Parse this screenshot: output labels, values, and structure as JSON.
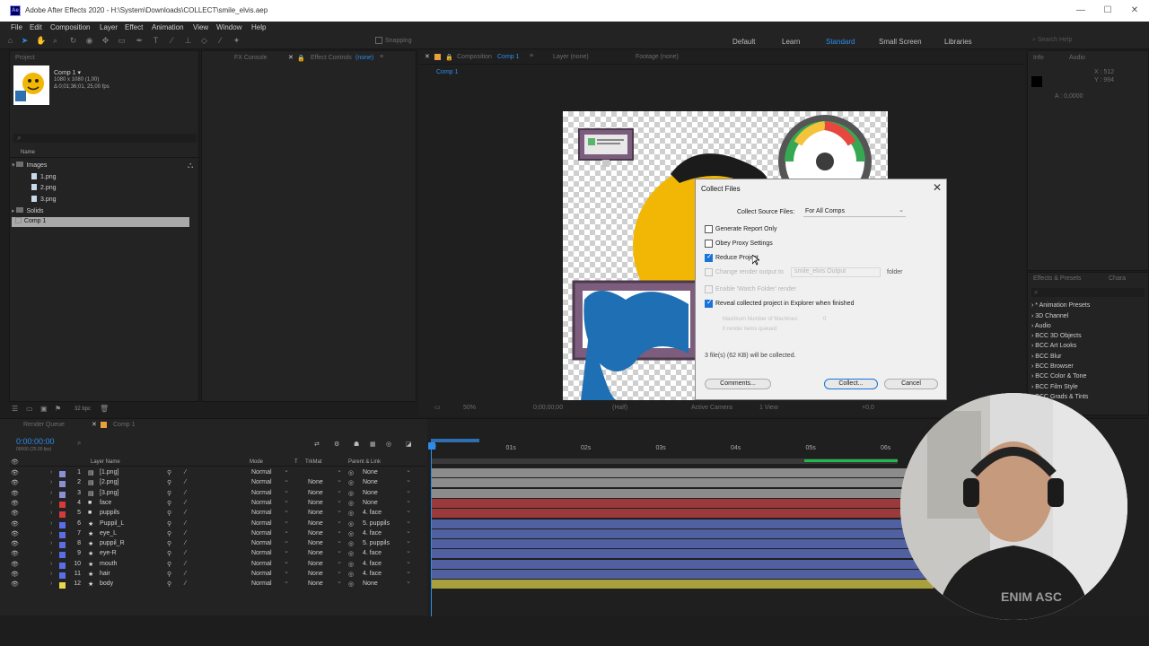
{
  "window": {
    "title": "Adobe After Effects 2020 - H:\\System\\Downloads\\COLLECT\\smile_elvis.aep",
    "logo_text": "Ae",
    "minimize": "—",
    "maximize": "☐",
    "close": "✕"
  },
  "menu": [
    "File",
    "Edit",
    "Composition",
    "Layer",
    "Effect",
    "Animation",
    "View",
    "Window",
    "Help"
  ],
  "toolbar": {
    "snapping": "Snapping",
    "workspaces": [
      "Default",
      "Learn",
      "Standard",
      "Small Screen",
      "Libraries"
    ],
    "active_workspace": "Standard",
    "search_placeholder": "Search Help"
  },
  "project": {
    "tab": "Project",
    "comp_name": "Comp 1 ▾",
    "comp_info1": "1080 x 1080 (1,00)",
    "comp_info2": "Δ 0;01;36;01, 25,00 fps",
    "name_header": "Name",
    "items": [
      {
        "label": "Images",
        "type": "folder"
      },
      {
        "label": "1.png",
        "type": "file"
      },
      {
        "label": "2.png",
        "type": "file"
      },
      {
        "label": "3.png",
        "type": "file"
      },
      {
        "label": "Solids",
        "type": "folder"
      },
      {
        "label": "Comp 1",
        "type": "comp"
      }
    ],
    "bpc": "32 bpc"
  },
  "effect_controls": {
    "fx_console": "FX Console",
    "tab": "Effect Controls",
    "none": "(none)"
  },
  "composition": {
    "tab": "Composition",
    "comp": "Comp 1",
    "layer_tab": "Layer (none)",
    "footage_tab": "Footage (none)",
    "sub_tab": "Comp 1",
    "zoom": "50%",
    "timecode": "0;00;00;00",
    "resolution": "(Half)",
    "camera": "Active Camera",
    "views": "1 View",
    "exposure": "+0,0"
  },
  "dialog": {
    "title": "Collect Files",
    "close": "✕",
    "source_label": "Collect Source Files:",
    "source_value": "For All Comps",
    "options": [
      {
        "label": "Generate Report Only",
        "checked": false,
        "disabled": false
      },
      {
        "label": "Obey Proxy Settings",
        "checked": false,
        "disabled": false
      },
      {
        "label": "Reduce Project",
        "checked": true,
        "disabled": false
      },
      {
        "label": "Change render output to",
        "checked": false,
        "disabled": true
      },
      {
        "label": "Enable 'Watch Folder' render",
        "checked": false,
        "disabled": true
      },
      {
        "label": "Reveal collected project in Explorer when finished",
        "checked": true,
        "disabled": false
      }
    ],
    "output_folder": "smile_elvis Output",
    "folder_label": "folder",
    "max_machines": "Maximum Number of Machines:",
    "max_machines_value": "0",
    "render_items": "0 render items queued",
    "summary": "3 file(s) (62 KB) will be collected.",
    "comments_btn": "Comments...",
    "collect_btn": "Collect...",
    "cancel_btn": "Cancel"
  },
  "info": {
    "tab": "Info",
    "audio_tab": "Audio",
    "x": "X : 512",
    "y": "Y : 994",
    "a": "A : 0,0000"
  },
  "effects": {
    "tab": "Effects & Presets",
    "char_tab": "Chara",
    "items": [
      "* Animation Presets",
      "3D Channel",
      "Audio",
      "BCC 3D Objects",
      "BCC Art Looks",
      "BCC Blur",
      "BCC Browser",
      "BCC Color & Tone",
      "BCC Film Style",
      "BCC Grads & Tints"
    ]
  },
  "timeline": {
    "render_queue": "Render Queue",
    "comp_tab": "Comp 1",
    "timecode": "0:00:00:00",
    "frame_info": "00000 (25.00 fps)",
    "columns": {
      "layer_name": "Layer Name",
      "mode": "Mode",
      "t": "T",
      "trkmat": "TrkMat",
      "parent": "Parent & Link"
    },
    "ruler": [
      "0f",
      "01s",
      "02s",
      "03s",
      "04s",
      "05s",
      "06s"
    ],
    "layers": [
      {
        "num": "1",
        "name": "[1.png]",
        "type": "file",
        "color": "#8b8fd6",
        "mode": "Normal",
        "trkmat": "",
        "parent": "None"
      },
      {
        "num": "2",
        "name": "[2.png]",
        "type": "file",
        "color": "#8b8fd6",
        "mode": "Normal",
        "trkmat": "None",
        "parent": "None"
      },
      {
        "num": "3",
        "name": "[3.png]",
        "type": "file",
        "color": "#8b8fd6",
        "mode": "Normal",
        "trkmat": "None",
        "parent": "None"
      },
      {
        "num": "4",
        "name": "face",
        "type": "solid",
        "color": "#d73a3a",
        "mode": "Normal",
        "trkmat": "None",
        "parent": "None"
      },
      {
        "num": "5",
        "name": "puppils",
        "type": "solid",
        "color": "#d73a3a",
        "mode": "Normal",
        "trkmat": "None",
        "parent": "4. face"
      },
      {
        "num": "6",
        "name": "Puppil_L",
        "type": "shape",
        "color": "#5b6ee6",
        "mode": "Normal",
        "trkmat": "None",
        "parent": "5. puppils"
      },
      {
        "num": "7",
        "name": "eye_L",
        "type": "shape",
        "color": "#5b6ee6",
        "mode": "Normal",
        "trkmat": "None",
        "parent": "4. face"
      },
      {
        "num": "8",
        "name": "puppil_R",
        "type": "shape",
        "color": "#5b6ee6",
        "mode": "Normal",
        "trkmat": "None",
        "parent": "5. puppils"
      },
      {
        "num": "9",
        "name": "eye-R",
        "type": "shape",
        "color": "#5b6ee6",
        "mode": "Normal",
        "trkmat": "None",
        "parent": "4. face"
      },
      {
        "num": "10",
        "name": "mouth",
        "type": "shape",
        "color": "#5b6ee6",
        "mode": "Normal",
        "trkmat": "None",
        "parent": "4. face"
      },
      {
        "num": "11",
        "name": "hair",
        "type": "shape",
        "color": "#5b6ee6",
        "mode": "Normal",
        "trkmat": "None",
        "parent": "4. face"
      },
      {
        "num": "12",
        "name": "body",
        "type": "shape",
        "color": "#e6d94a",
        "mode": "Normal",
        "trkmat": "None",
        "parent": "None"
      }
    ],
    "bar_colors": [
      "#8c8c8c",
      "#8c8c8c",
      "#8c8c8c",
      "#9a3a3a",
      "#9a3a3a",
      "#5060a0",
      "#5060a0",
      "#5060a0",
      "#5060a0",
      "#5060a0",
      "#5060a0",
      "#a8a03c"
    ]
  },
  "webcam": {
    "shirt_text": "ENIM ASC"
  }
}
